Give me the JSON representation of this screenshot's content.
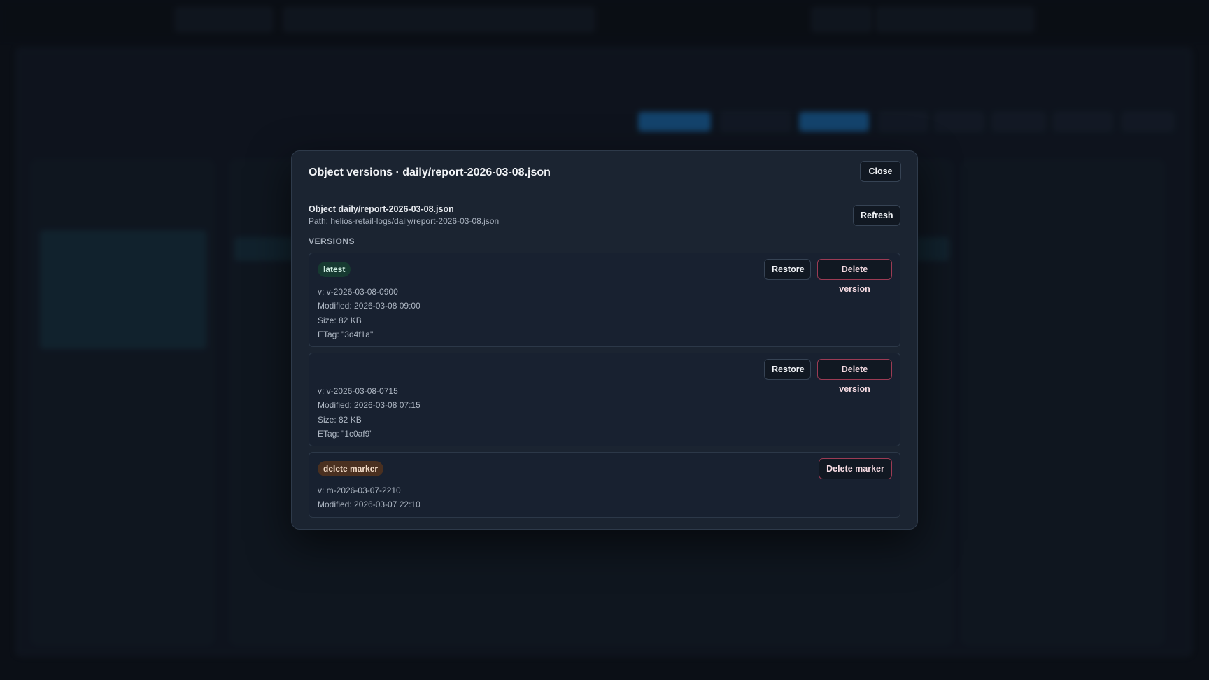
{
  "modal": {
    "title": "Object versions · daily/report-2026-03-08.json",
    "close_label": "Close",
    "refresh_label": "Refresh",
    "object_line": "Object daily/report-2026-03-08.json",
    "path_line": "Path: helios-retail-logs/daily/report-2026-03-08.json",
    "section_label": "VERSIONS",
    "versions": [
      {
        "badge": "latest",
        "restore_label": "Restore",
        "delete_label": "Delete version",
        "version": "v: v-2026-03-08-0900",
        "modified": "Modified: 2026-03-08 09:00",
        "size": "Size: 82 KB",
        "etag": "ETag: \"3d4f1a\""
      },
      {
        "restore_label": "Restore",
        "delete_label": "Delete version",
        "version": "v: v-2026-03-08-0715",
        "modified": "Modified: 2026-03-08 07:15",
        "size": "Size: 82 KB",
        "etag": "ETag: \"1c0af9\""
      },
      {
        "badge": "delete marker",
        "delete_label": "Delete marker",
        "version": "v: m-2026-03-07-2210",
        "modified": "Modified: 2026-03-07 22:10"
      }
    ]
  },
  "colors": {
    "overlay": "#0b0f16",
    "modal_bg": "#1b2431",
    "latest_badge": "#173a31",
    "marker_badge": "#4a3020",
    "danger_border": "#9c3b54"
  }
}
